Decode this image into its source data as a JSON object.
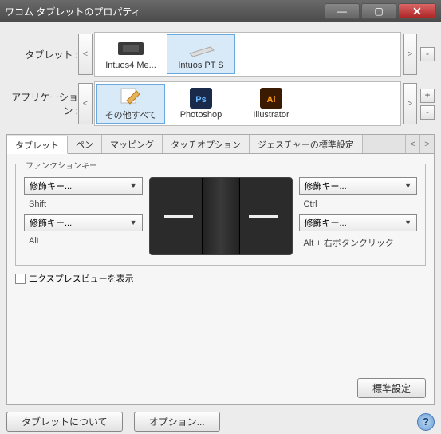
{
  "window": {
    "title": "ワコム タブレットのプロパティ"
  },
  "tablet_row": {
    "label": "タブレット :",
    "items": [
      {
        "label": "Intuos4 Me...",
        "selected": false
      },
      {
        "label": "Intuos PT S",
        "selected": true
      }
    ]
  },
  "app_row": {
    "label": "アプリケーション :",
    "items": [
      {
        "label": "その他すべて",
        "selected": true
      },
      {
        "label": "Photoshop",
        "selected": false
      },
      {
        "label": "Illustrator",
        "selected": false
      }
    ]
  },
  "tabs": {
    "items": [
      {
        "label": "タブレット",
        "active": true
      },
      {
        "label": "ペン"
      },
      {
        "label": "マッピング"
      },
      {
        "label": "タッチオプション"
      },
      {
        "label": "ジェスチャーの標準設定"
      }
    ]
  },
  "panel": {
    "group_label": "ファンクションキー",
    "left": [
      {
        "combo": "修飾キー...",
        "sub": "Shift"
      },
      {
        "combo": "修飾キー...",
        "sub": "Alt"
      }
    ],
    "right": [
      {
        "combo": "修飾キー...",
        "sub": "Ctrl"
      },
      {
        "combo": "修飾キー...",
        "sub": "Alt + 右ボタンクリック"
      }
    ],
    "expressview_label": "エクスプレスビューを表示",
    "default_button": "標準設定"
  },
  "footer": {
    "about": "タブレットについて",
    "options": "オプション..."
  }
}
